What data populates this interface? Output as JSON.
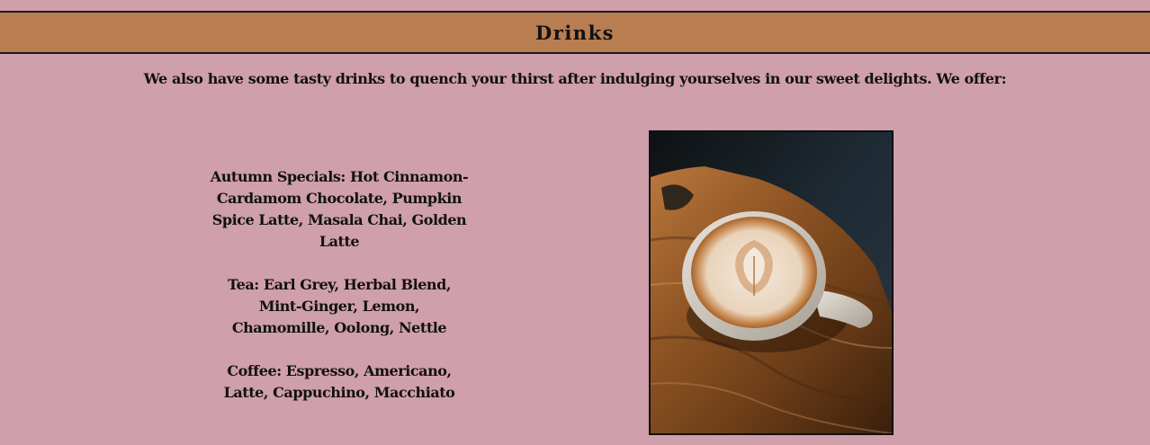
{
  "section": {
    "title": "Drinks",
    "intro": "We also have some tasty drinks to quench your thirst after indulging yourselves in our sweet delights. We offer:"
  },
  "menu": [
    {
      "label": "Autumn Specials:",
      "items": " Hot Cinnamon-Cardamom Chocolate, Pumpkin Spice Latte, Masala Chai, Golden Latte"
    },
    {
      "label": "Tea:",
      "items": " Earl Grey, Herbal Blend, Mint-Ginger, Lemon, Chamomille, Oolong, Nettle"
    },
    {
      "label": "Coffee:",
      "items": " Espresso, Americano, Latte, Cappuchino, Macchiato"
    }
  ],
  "photo": {
    "subject": "latte-art-cup-on-wooden-board"
  }
}
